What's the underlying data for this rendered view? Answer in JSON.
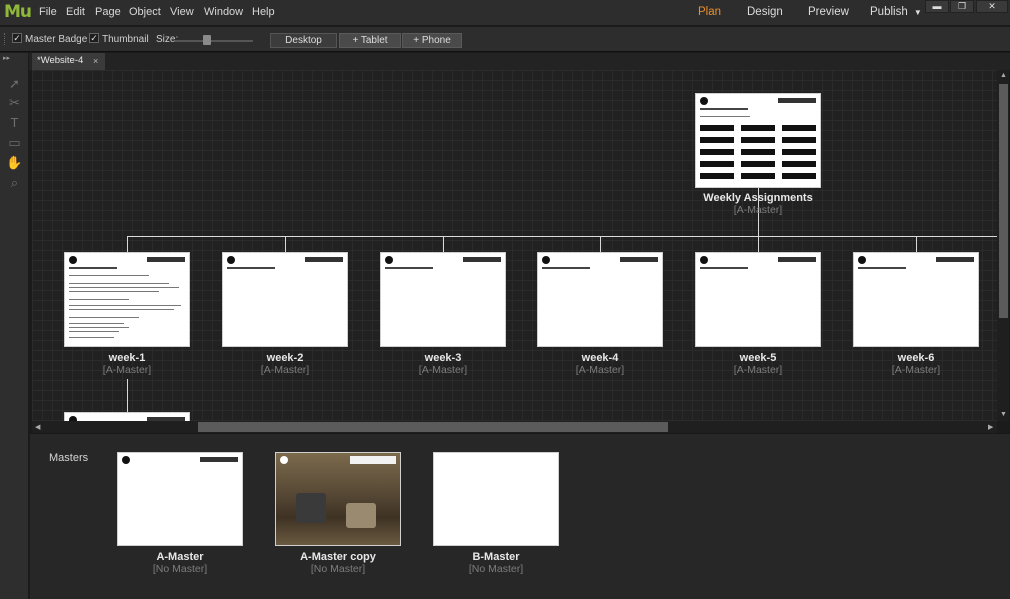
{
  "app": {
    "logo": "Mu"
  },
  "menu": [
    "File",
    "Edit",
    "Page",
    "Object",
    "View",
    "Window",
    "Help"
  ],
  "modes": {
    "plan": "Plan",
    "design": "Design",
    "preview": "Preview",
    "publish": "Publish"
  },
  "window_controls": {
    "minimize": "▬",
    "restore": "❐",
    "close": "✕"
  },
  "toolbar": {
    "master_badge": "Master Badge",
    "thumbnail": "Thumbnail",
    "size_label": "Size:",
    "desktop": "Desktop",
    "tablet": "+ Tablet",
    "phone": "+ Phone"
  },
  "tab": {
    "label": "*Website-4",
    "close": "×"
  },
  "root_page": {
    "name": "Weekly Assignments",
    "master": "[A-Master]"
  },
  "pages": [
    {
      "name": "week-1",
      "master": "[A-Master]"
    },
    {
      "name": "week-2",
      "master": "[A-Master]"
    },
    {
      "name": "week-3",
      "master": "[A-Master]"
    },
    {
      "name": "week-4",
      "master": "[A-Master]"
    },
    {
      "name": "week-5",
      "master": "[A-Master]"
    },
    {
      "name": "week-6",
      "master": "[A-Master]"
    }
  ],
  "masters": {
    "title": "Masters",
    "items": [
      {
        "name": "A-Master",
        "master": "[No Master]"
      },
      {
        "name": "A-Master copy",
        "master": "[No Master]"
      },
      {
        "name": "B-Master",
        "master": "[No Master]"
      }
    ]
  },
  "colors": {
    "accent": "#e8902c",
    "logo": "#8fb83a"
  }
}
